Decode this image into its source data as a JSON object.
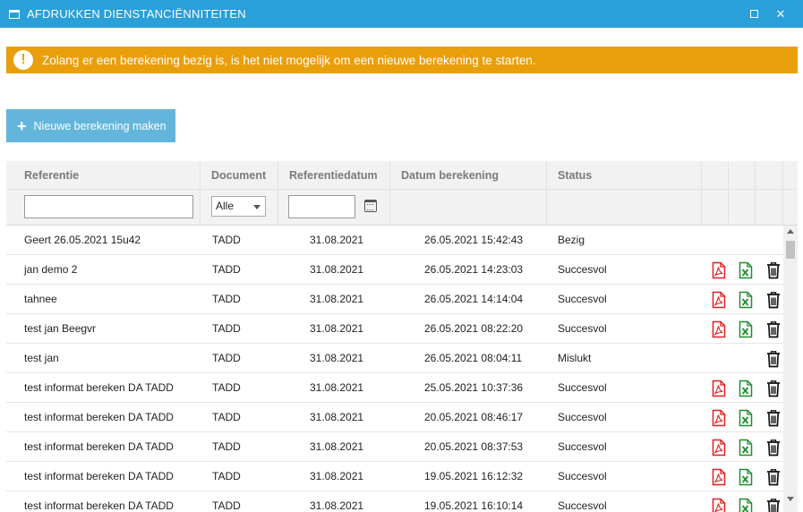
{
  "window": {
    "title": "AFDRUKKEN DIENSTANCIËNNITEITEN",
    "maximize_icon": "maximize-icon",
    "close_icon": "close-icon",
    "close_glyph": "✕"
  },
  "warning": {
    "icon_glyph": "!",
    "message": "Zolang er een berekening bezig is, is het niet mogelijk om een nieuwe berekening te starten."
  },
  "actions": {
    "new_calculation_label": "Nieuwe berekening maken",
    "plus_glyph": "+"
  },
  "table": {
    "columns": {
      "reference": "Referentie",
      "document": "Document",
      "reference_date": "Referentiedatum",
      "calculation_date": "Datum berekening",
      "status": "Status"
    },
    "filters": {
      "reference_value": "",
      "document_selected": "Alle",
      "reference_date_value": ""
    },
    "rows": [
      {
        "reference": "Geert 26.05.2021 15u42",
        "document": "TADD",
        "reference_date": "31.08.2021",
        "calculation_date": "26.05.2021 15:42:43",
        "status": "Bezig",
        "pdf": false,
        "xls": false,
        "del": false
      },
      {
        "reference": "jan demo 2",
        "document": "TADD",
        "reference_date": "31.08.2021",
        "calculation_date": "26.05.2021 14:23:03",
        "status": "Succesvol",
        "pdf": true,
        "xls": true,
        "del": true
      },
      {
        "reference": "tahnee",
        "document": "TADD",
        "reference_date": "31.08.2021",
        "calculation_date": "26.05.2021 14:14:04",
        "status": "Succesvol",
        "pdf": true,
        "xls": true,
        "del": true
      },
      {
        "reference": "test jan Beegvr",
        "document": "TADD",
        "reference_date": "31.08.2021",
        "calculation_date": "26.05.2021 08:22:20",
        "status": "Succesvol",
        "pdf": true,
        "xls": true,
        "del": true
      },
      {
        "reference": "test jan",
        "document": "TADD",
        "reference_date": "31.08.2021",
        "calculation_date": "26.05.2021 08:04:11",
        "status": "Mislukt",
        "pdf": false,
        "xls": false,
        "del": true
      },
      {
        "reference": "test informat bereken DA TADD",
        "document": "TADD",
        "reference_date": "31.08.2021",
        "calculation_date": "25.05.2021 10:37:36",
        "status": "Succesvol",
        "pdf": true,
        "xls": true,
        "del": true
      },
      {
        "reference": "test informat bereken DA TADD",
        "document": "TADD",
        "reference_date": "31.08.2021",
        "calculation_date": "20.05.2021 08:46:17",
        "status": "Succesvol",
        "pdf": true,
        "xls": true,
        "del": true
      },
      {
        "reference": "test informat bereken DA TADD",
        "document": "TADD",
        "reference_date": "31.08.2021",
        "calculation_date": "20.05.2021 08:37:53",
        "status": "Succesvol",
        "pdf": true,
        "xls": true,
        "del": true
      },
      {
        "reference": "test informat bereken DA TADD",
        "document": "TADD",
        "reference_date": "31.08.2021",
        "calculation_date": "19.05.2021 16:12:32",
        "status": "Succesvol",
        "pdf": true,
        "xls": true,
        "del": true
      },
      {
        "reference": "test informat bereken DA TADD",
        "document": "TADD",
        "reference_date": "31.08.2021",
        "calculation_date": "19.05.2021 16:10:14",
        "status": "Succesvol",
        "pdf": true,
        "xls": true,
        "del": true
      }
    ]
  },
  "colors": {
    "titlebar": "#2a9fd8",
    "warning": "#e99f0c",
    "button": "#64b5dc",
    "pdf_icon": "#e02020",
    "xls_icon": "#1e8f2e",
    "delete_icon": "#111111"
  },
  "icons": {
    "pdf": "pdf-icon",
    "xls": "excel-icon",
    "delete": "trash-icon",
    "calendar": "calendar-icon",
    "warning": "exclamation-icon",
    "window": "window-icon"
  }
}
